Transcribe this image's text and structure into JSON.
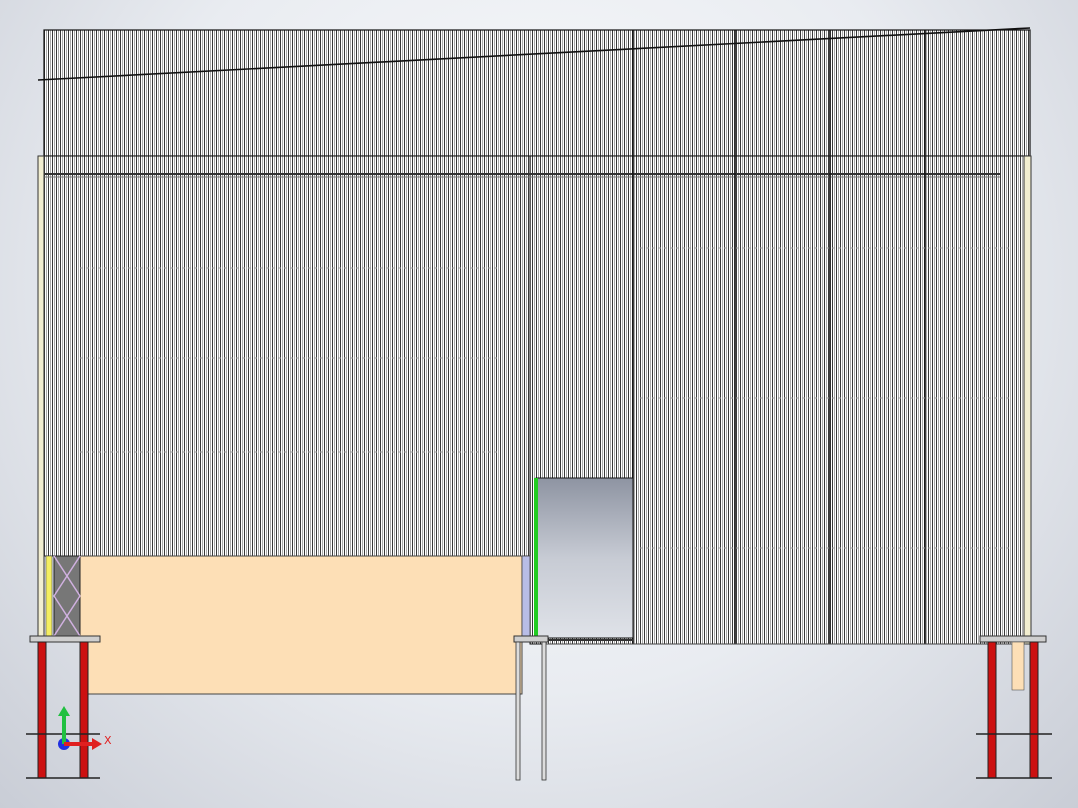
{
  "viewport": {
    "background_top": "#fbfcfd",
    "background_bottom": "#c9cdd6"
  },
  "model": {
    "cladding_color": "#2a2a2a",
    "panel_fill": "#ffffff",
    "wall_fill_color": "#fddfb6",
    "column_color": "#cc1111",
    "brace_color": "#e8e070",
    "door_frame_color": "#22cc22",
    "opening_shadow": "#9ea3b0"
  },
  "triad": {
    "x_label": "X",
    "x_color": "#e02020",
    "y_color": "#20c040",
    "z_color": "#2030e0"
  }
}
